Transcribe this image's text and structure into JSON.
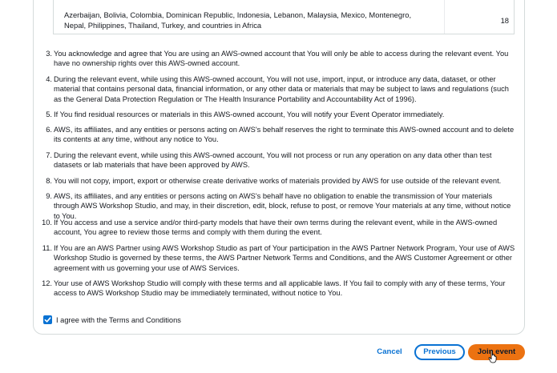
{
  "region_table": {
    "countries": "Azerbaijan, Bolivia, Colombia, Dominican Republic, Indonesia, Lebanon, Malaysia, Mexico, Montenegro, Nepal, Philippines, Thailand, Turkey, and countries in Africa",
    "count": "18"
  },
  "terms": [
    {
      "num": "3.",
      "text": "You acknowledge and agree that You are using an AWS-owned account that You will only be able to access during the relevant event. You have no ownership rights over this AWS-owned account."
    },
    {
      "num": "4.",
      "text": "During the relevant event, while using this AWS-owned account, You will not use, import, input, or introduce any data, dataset, or other material that contains personal data, financial information, or any other data or materials that may be subject to laws and regulations (such as the General Data Protection Regulation or The Health Insurance Portability and Accountability Act of 1996)."
    },
    {
      "num": "5.",
      "text": "If You find residual resources or materials in this AWS-owned account, You will notify your Event Operator immediately."
    },
    {
      "num": "6.",
      "text": "AWS, its affiliates, and any entities or persons acting on AWS's behalf reserves the right to terminate this AWS-owned account and to delete its contents at any time, without any notice to You."
    },
    {
      "num": "7.",
      "text": "During the relevant event, while using this AWS-owned account, You will not process or run any operation on any data other than test datasets or lab materials that have been approved by AWS."
    },
    {
      "num": "8.",
      "text": "You will not copy, import, export or otherwise create derivative works of materials provided by AWS for use outside of the relevant event."
    },
    {
      "num": "9.",
      "text": "AWS, its affiliates, and any entities or persons acting on AWS's behalf have no obligation to enable the transmission of Your materials through AWS Workshop Studio, and may, in their discretion, edit, block, refuse to post, or remove Your materials at any time, without notice to You."
    },
    {
      "num": "10.",
      "text": "If You access and use a service and/or third-party models that have their own terms during the relevant event, while in the AWS-owned account, You agree to review those terms and comply with them during the event."
    },
    {
      "num": "11.",
      "text": "If You are an AWS Partner using AWS Workshop Studio as part of Your participation in the AWS Partner Network Program, Your use of AWS Workshop Studio is governed by these terms, the AWS Partner Network Terms and Conditions, and the AWS Customer Agreement or other agreement with us governing your use of AWS Services."
    },
    {
      "num": "12.",
      "text": "Your use of AWS Workshop Studio will comply with these terms and all applicable laws. If You fail to comply with any of these terms, Your access to AWS Workshop Studio may be immediately terminated, without notice to You."
    }
  ],
  "agreement": {
    "label": "I agree with the Terms and Conditions",
    "checked": true
  },
  "actions": {
    "cancel": "Cancel",
    "previous": "Previous",
    "join": "Join event"
  },
  "colors": {
    "link_blue": "#0972d3",
    "primary_orange": "#ec7211",
    "border": "#d5dbdb"
  }
}
